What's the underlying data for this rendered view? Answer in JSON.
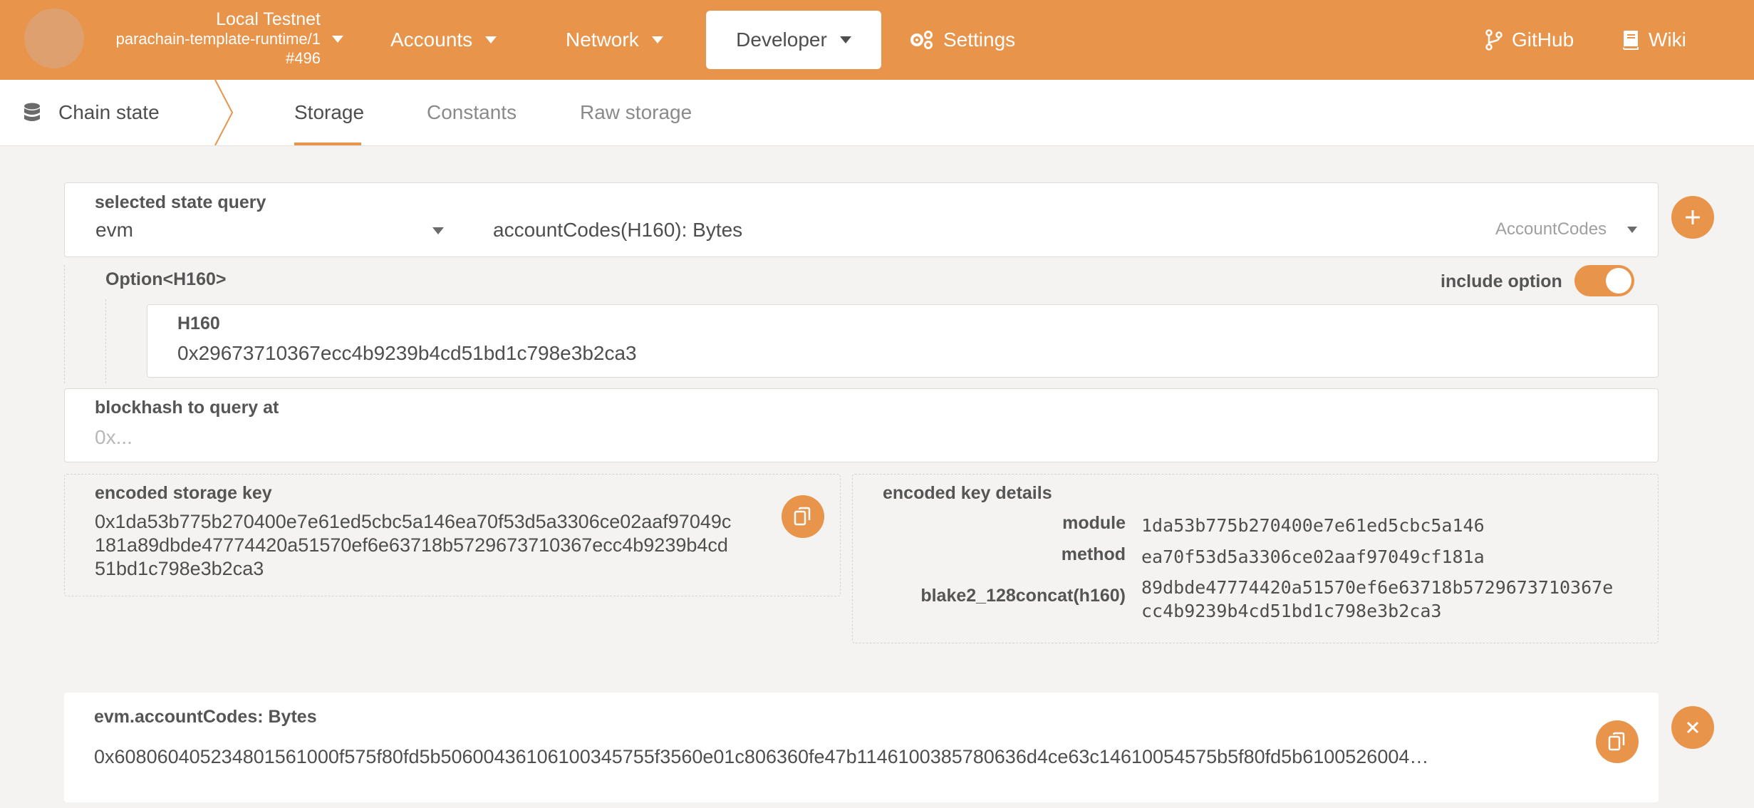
{
  "header": {
    "chain_name": "Local Testnet",
    "runtime": "parachain-template-runtime/1",
    "block": "#496",
    "nav": [
      {
        "label": "Accounts"
      },
      {
        "label": "Network"
      },
      {
        "label": "Developer"
      },
      {
        "label": "Settings"
      }
    ],
    "links": [
      {
        "label": "GitHub"
      },
      {
        "label": "Wiki"
      }
    ],
    "accent_color": "#e8944a"
  },
  "subnav": {
    "section": "Chain state",
    "tabs": [
      {
        "label": "Storage",
        "active": true
      },
      {
        "label": "Constants",
        "active": false
      },
      {
        "label": "Raw storage",
        "active": false
      }
    ]
  },
  "query": {
    "label": "selected state query",
    "module": "evm",
    "method_signature": "accountCodes(H160): Bytes",
    "method_name": "AccountCodes",
    "option_label": "Option<H160>",
    "include_option_label": "include option",
    "include_option": true,
    "h160_label": "H160",
    "h160_value": "0x29673710367ecc4b9239b4cd51bd1c798e3b2ca3",
    "blockhash_label": "blockhash to query at",
    "blockhash_placeholder": "0x..."
  },
  "encoded": {
    "key_label": "encoded storage key",
    "key_lines": [
      "0x1da53b775b270400e7e61ed5cbc5a146ea70f53d5a3306ce02aaf97049c",
      "181a89dbde47774420a51570ef6e63718b5729673710367ecc4b9239b4cd",
      "51bd1c798e3b2ca3"
    ],
    "details_label": "encoded key details",
    "details": [
      {
        "label": "module",
        "value": "1da53b775b270400e7e61ed5cbc5a146"
      },
      {
        "label": "method",
        "value": "ea70f53d5a3306ce02aaf97049cf181a"
      },
      {
        "label": "blake2_128concat(h160)",
        "value_lines": [
          "89dbde47774420a51570ef6e63718b5729673710367e",
          "cc4b9239b4cd51bd1c798e3b2ca3"
        ]
      }
    ]
  },
  "result": {
    "label": "evm.accountCodes: Bytes",
    "value": "0x608060405234801561000f575f80fd5b50600436106100345755f3560e01c806360fe47b1146100385780636d4ce63c14610054575b5f80fd5b6100526004…"
  }
}
